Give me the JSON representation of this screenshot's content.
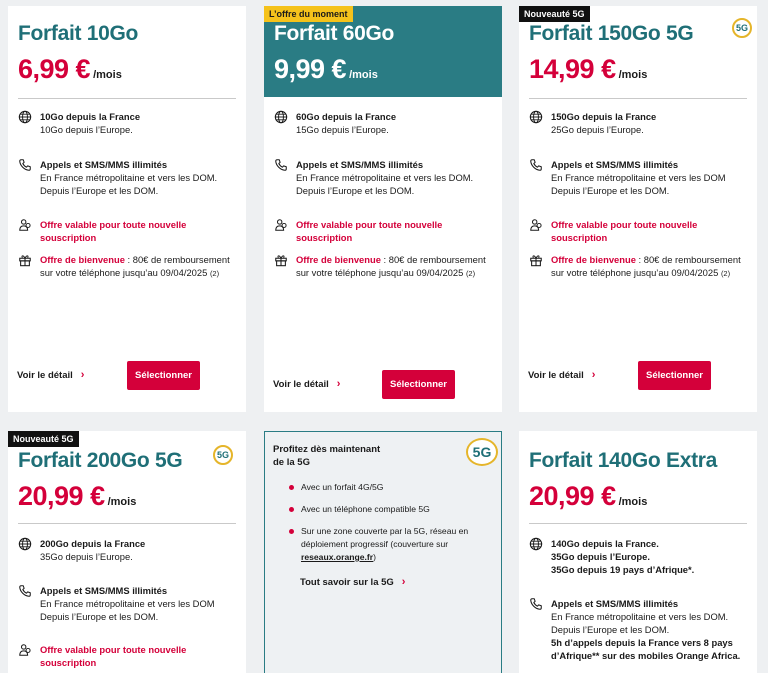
{
  "cards": [
    {
      "title": "Forfait 10Go",
      "price": "6,99 €",
      "per": "/mois",
      "data_l1": "10Go depuis la France",
      "data_l2": "10Go depuis l’Europe.",
      "calls_title": "Appels et SMS/MMS illimités",
      "calls_l1": "En France métropolitaine et vers les DOM.",
      "calls_l2": "Depuis l’Europe et les DOM.",
      "offer": "Offre valable pour toute nouvelle souscription",
      "welcome_label": "Offre de bienvenue",
      "welcome_l1": " : 80€ de remboursement",
      "welcome_l2": "sur votre téléphone jusqu’au 09/04/2025",
      "welcome_note": "(2)",
      "detail": "Voir le détail",
      "select": "Sélectionner"
    },
    {
      "badge": "L’offre du moment",
      "title": "Forfait 60Go",
      "price": "9,99 €",
      "per": "/mois",
      "data_l1": "60Go depuis la France",
      "data_l2": "15Go depuis l’Europe.",
      "calls_title": "Appels et SMS/MMS illimités",
      "calls_l1": "En France métropolitaine et vers les DOM.",
      "calls_l2": "Depuis l’Europe et les DOM.",
      "offer": "Offre valable pour toute nouvelle souscription",
      "welcome_label": "Offre de bienvenue",
      "welcome_l1": " : 80€ de remboursement",
      "welcome_l2": "sur votre téléphone jusqu’au 09/04/2025",
      "welcome_note": "(2)",
      "detail": "Voir le détail",
      "select": "Sélectionner"
    },
    {
      "badge": "Nouveauté 5G",
      "logo": "5G",
      "title": "Forfait 150Go 5G",
      "price": "14,99 €",
      "per": "/mois",
      "data_l1": "150Go depuis la France",
      "data_l2": "25Go depuis l’Europe.",
      "calls_title": "Appels et SMS/MMS illimités",
      "calls_l1": "En France métropolitaine et vers les DOM",
      "calls_l2": "Depuis l’Europe et les DOM.",
      "offer": "Offre valable pour toute nouvelle souscription",
      "welcome_label": "Offre de bienvenue",
      "welcome_l1": " : 80€ de remboursement",
      "welcome_l2": "sur votre téléphone jusqu’au 09/04/2025",
      "welcome_note": "(2)",
      "detail": "Voir le détail",
      "select": "Sélectionner"
    },
    {
      "badge": "Nouveauté 5G",
      "logo": "5G",
      "title": "Forfait 200Go 5G",
      "price": "20,99 €",
      "per": "/mois",
      "data_l1": "200Go depuis la France",
      "data_l2": "35Go depuis l’Europe.",
      "calls_title": "Appels et SMS/MMS illimités",
      "calls_l1": "En France métropolitaine et vers les DOM",
      "calls_l2": "Depuis l’Europe et les DOM.",
      "offer": "Offre valable pour toute nouvelle souscription"
    },
    {
      "logo": "5G",
      "title_l1": "Profitez dès maintenant",
      "title_l2": "de la 5G",
      "b1": "Avec un forfait 4G/5G",
      "b2": "Avec un téléphone compatible 5G",
      "b3_l1": "Sur une zone couverte par la 5G, réseau en",
      "b3_l2": "déploiement progressif (couverture sur",
      "b3_link": "reseaux.orange.fr",
      "b3_end": ")",
      "more": "Tout savoir sur la 5G"
    },
    {
      "title": "Forfait 140Go Extra",
      "price": "20,99 €",
      "per": "/mois",
      "data_l1": "140Go depuis la France.",
      "data_l2": "35Go depuis l’Europe.",
      "data_l3": "35Go depuis 19 pays d’Afrique*.",
      "calls_title": "Appels et SMS/MMS illimités",
      "calls_l1": "En France métropolitaine et vers les DOM.",
      "calls_l2": "Depuis l’Europe et les DOM.",
      "calls_l3": "5h d’appels depuis la France vers 8 pays",
      "calls_l4": "d’Afrique** sur des mobiles Orange Africa."
    }
  ],
  "chevron": "›",
  "colors": {
    "accent": "#d4003a",
    "teal": "#2a7c84",
    "badge_yellow": "#f5c21b"
  },
  "icons": [
    "globe-icon",
    "phone-icon",
    "people-icon",
    "gift-icon",
    "chevron-right-icon",
    "5g-logo-icon"
  ]
}
